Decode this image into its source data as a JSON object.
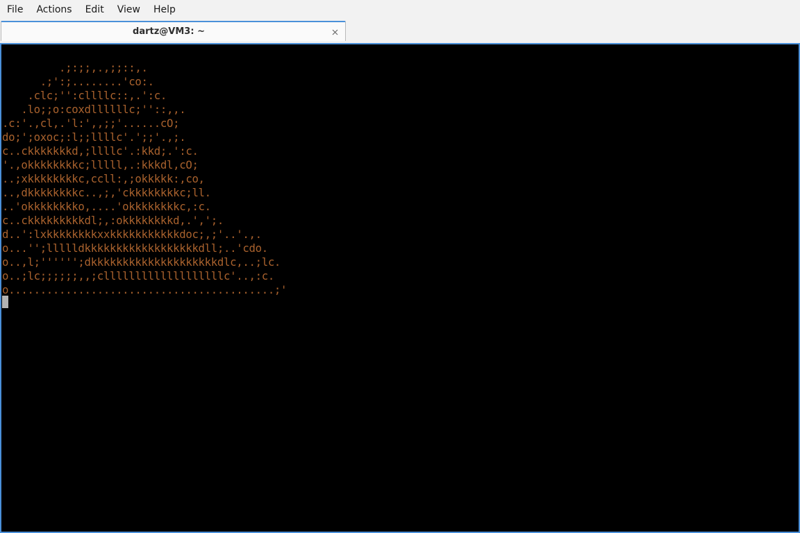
{
  "menubar": {
    "items": [
      "File",
      "Actions",
      "Edit",
      "View",
      "Help"
    ]
  },
  "tab": {
    "title": "dartz@VM3: ~",
    "close_icon": "close-icon"
  },
  "terminal": {
    "text_color": "#a8612d",
    "background": "#000000",
    "lines": [
      "         .;:;;,.,;;::,.",
      "      .;':;........'co:.",
      "    .clc;'':cllllc::,.':c.",
      "   .lo;;o:coxdllllllc;''::,,.",
      ".c:'.,cl,.'l:',,;;'......cO;",
      "do;';oxoc;:l;;llllc'.';;'.,;.",
      "c..ckkkkkkkd,;llllc'.:kkd;.':c.",
      "'.,okkkkkkkkc;lllll,.:kkkdl,cO;",
      "..;xkkkkkkkkc,ccll:,;okkkkk:,co,",
      "..,dkkkkkkkkc..,;,'ckkkkkkkkc;ll.",
      "..'okkkkkkkko,....'okkkkkkkkc,:c.",
      "c..ckkkkkkkkkdl;,:okkkkkkkkd,.',';.",
      "d..':lxkkkkkkkkxxkkkkkkkkkkkdoc;,;'..'.,.",
      "o...'';llllldkkkkkkkkkkkkkkkkkkdll;..'cdo.",
      "o..,l;'''''';dkkkkkkkkkkkkkkkkkkkkdlc,..;lc.",
      "o..;lc;;;;;;,,;clllllllllllllllllllc'..,:c.",
      "o..........................................;'"
    ]
  }
}
